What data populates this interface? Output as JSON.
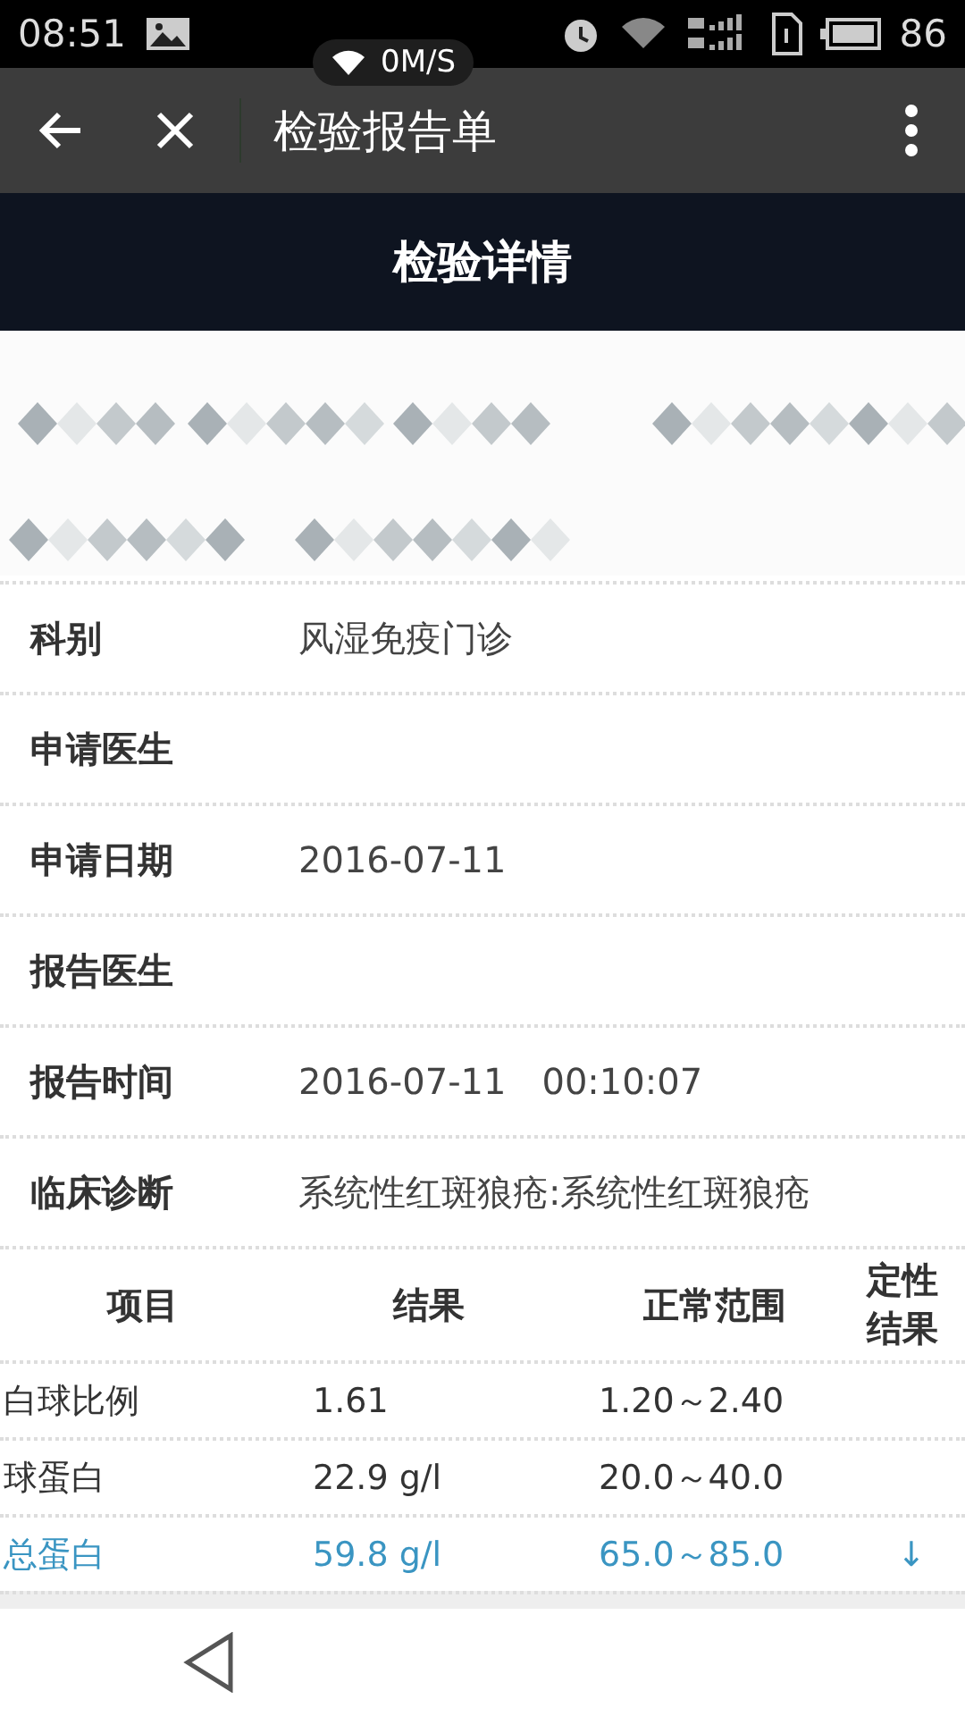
{
  "status_bar": {
    "time": "08:51",
    "speed": "0M/S",
    "battery": "86"
  },
  "app_bar": {
    "title": "检验报告单"
  },
  "header": {
    "title": "检验详情"
  },
  "fields": [
    {
      "label": "科别",
      "value": "风湿免疫门诊"
    },
    {
      "label": "申请医生"
    },
    {
      "label": "申请日期",
      "value": "2016-07-11"
    },
    {
      "label": "报告医生"
    },
    {
      "label": "报告时间",
      "value": "2016-07-11　00:10:07"
    },
    {
      "label": "临床诊断",
      "value": "系统性红斑狼疮:系统性红斑狼疮"
    }
  ],
  "table": {
    "columns": [
      "项目",
      "结果",
      "正常范围",
      "定性结果"
    ],
    "rows": [
      {
        "cells": [
          "白球比例",
          "1.61",
          "1.20～2.40"
        ],
        "abnormal": false
      },
      {
        "cells": [
          "球蛋白",
          "22.9 g/l",
          "20.0～40.0"
        ],
        "abnormal": false
      },
      {
        "cells": [
          "总蛋白",
          "59.8 g/l",
          "65.0～85.0",
          "↓"
        ],
        "abnormal": true
      }
    ]
  }
}
